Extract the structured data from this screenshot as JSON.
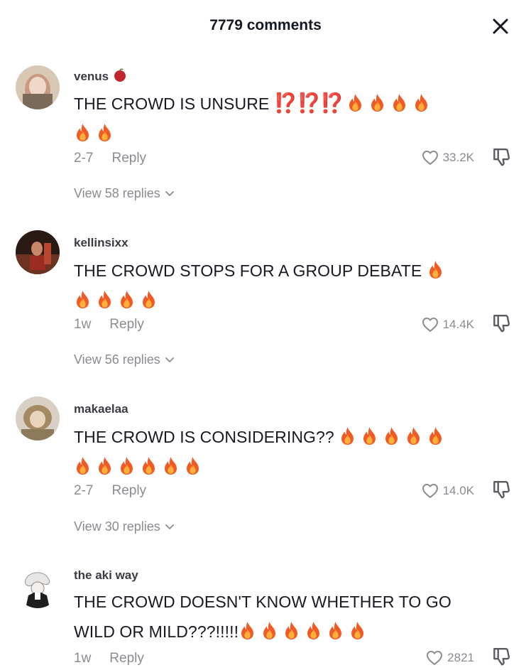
{
  "header": {
    "title": "7779 comments"
  },
  "comments": [
    {
      "username": "venus",
      "text": "THE CROWD IS UNSURE",
      "punct": "⁉️⁉️⁉️",
      "date": "2-7",
      "reply_label": "Reply",
      "likes": "33.2K",
      "view_replies": "View 58 replies"
    },
    {
      "username": "kellinsixx",
      "text": "THE CROWD STOPS FOR A GROUP DEBATE",
      "date": "1w",
      "reply_label": "Reply",
      "likes": "14.4K",
      "view_replies": "View 56 replies"
    },
    {
      "username": "makaelaa",
      "text": "THE CROWD IS CONSIDERING??",
      "date": "2-7",
      "reply_label": "Reply",
      "likes": "14.0K",
      "view_replies": "View 30 replies"
    },
    {
      "username": "the aki way",
      "text_line1": "THE CROWD DOESN'T KNOW WHETHER TO GO",
      "text_line2": "WILD OR MILD???!!!!!",
      "date": "1w",
      "reply_label": "Reply",
      "likes": "2821"
    }
  ],
  "colors": {
    "text": "#161823",
    "muted": "#8a8b91",
    "flame_outer": "#f15a24",
    "flame_inner": "#fbb03b",
    "interrobang": "#e0202c"
  }
}
